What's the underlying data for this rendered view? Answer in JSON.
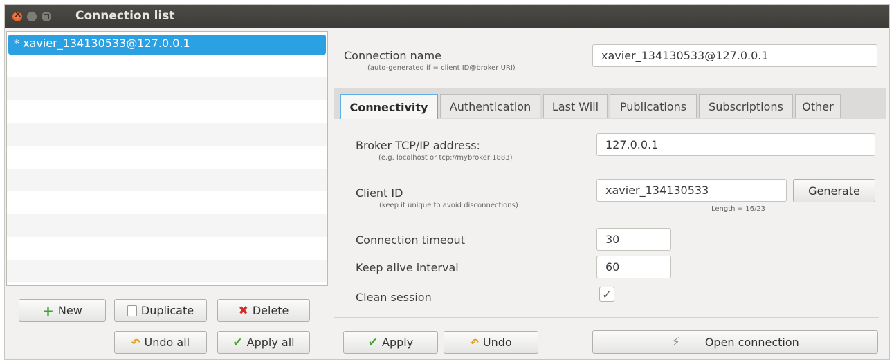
{
  "window": {
    "title": "Connection list"
  },
  "connections": [
    {
      "label": "* xavier_134130533@127.0.0.1",
      "selected": true
    }
  ],
  "list_buttons": {
    "new": "New",
    "duplicate": "Duplicate",
    "delete": "Delete",
    "undo_all": "Undo all",
    "apply_all": "Apply all"
  },
  "connection_name": {
    "label": "Connection name",
    "hint": "(auto-generated if = client ID@broker URI)",
    "value": "xavier_134130533@127.0.0.1"
  },
  "tabs": [
    {
      "label": "Connectivity",
      "active": true
    },
    {
      "label": "Authentication",
      "active": false
    },
    {
      "label": "Last Will",
      "active": false
    },
    {
      "label": "Publications",
      "active": false
    },
    {
      "label": "Subscriptions",
      "active": false
    },
    {
      "label": "Other",
      "active": false
    }
  ],
  "connectivity": {
    "broker": {
      "label": "Broker TCP/IP address:",
      "hint": "(e.g. localhost or tcp://mybroker:1883)",
      "value": "127.0.0.1"
    },
    "client_id": {
      "label": "Client ID",
      "hint": "(keep it unique to avoid disconnections)",
      "value": "xavier_134130533",
      "generate_label": "Generate",
      "length_text": "Length = 16/23"
    },
    "timeout": {
      "label": "Connection timeout",
      "value": "30"
    },
    "keepalive": {
      "label": "Keep alive interval",
      "value": "60"
    },
    "clean_session": {
      "label": "Clean session",
      "checked": true,
      "check_glyph": "✓"
    }
  },
  "bottom_buttons": {
    "apply": "Apply",
    "undo": "Undo",
    "open_connection": "Open connection"
  },
  "icons": {
    "plus": "+",
    "cross": "✖",
    "check": "✔",
    "undo": "↶",
    "plug": "⚡"
  },
  "colors": {
    "selection": "#2ba1e3",
    "titlebar": "#3c3b37",
    "close_button": "#df4b16"
  }
}
